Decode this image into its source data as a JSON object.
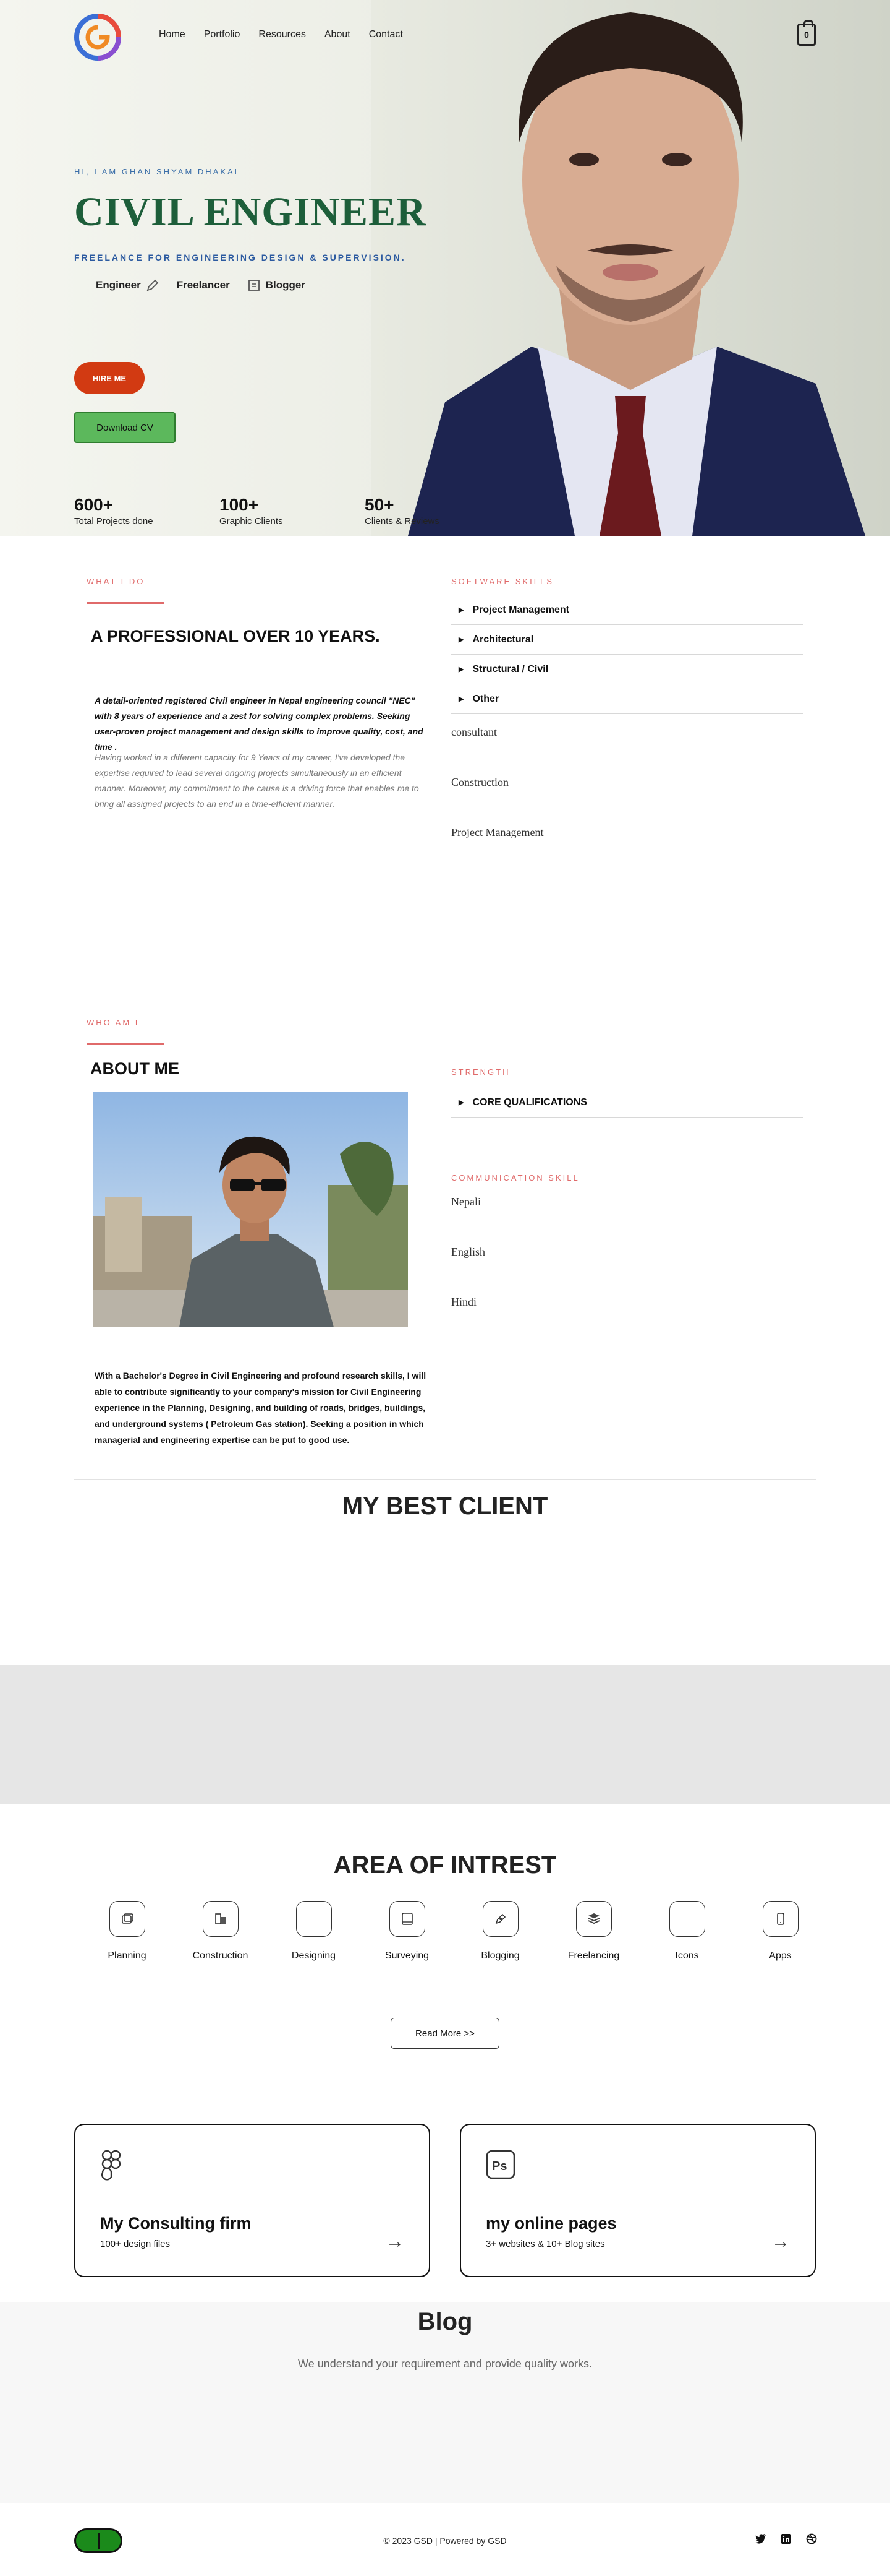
{
  "nav": {
    "items": [
      "Home",
      "Portfolio",
      "Resources",
      "About",
      "Contact"
    ],
    "cart_count": "0"
  },
  "hero": {
    "greeting": "HI, I AM GHAN SHYAM DHAKAL",
    "title": "CIVIL ENGINEER",
    "tagline": "FREELANCE FOR ENGINEERING DESIGN & SUPERVISION.",
    "roles": [
      "Engineer",
      "Freelancer",
      "Blogger"
    ],
    "hire_label": "HIRE ME",
    "cv_label": "Download CV",
    "stats": [
      {
        "number": "600+",
        "label": "Total Projects done"
      },
      {
        "number": "100+",
        "label": "Graphic Clients"
      },
      {
        "number": "50+",
        "label": "Clients & Reviews"
      }
    ]
  },
  "what_i_do": {
    "label": "WHAT I DO",
    "heading": "A PROFESSIONAL OVER 10 YEARS.",
    "intro_bold": "A detail-oriented registered Civil engineer in Nepal engineering council \"NEC\" with 8 years of experience and a zest for solving complex problems. Seeking user-proven project management and design skills to improve quality, cost, and time .",
    "intro_body": "Having worked in a different capacity for 9 Years of my career, I've developed the expertise required to lead several ongoing projects simultaneously in an efficient manner. Moreover, my commitment to the cause is a driving force that enables me to bring all assigned projects to an end in a time-efficient manner."
  },
  "software_skills": {
    "label": "SOFTWARE SKILLS",
    "accordion": [
      "Project Management",
      "Architectural",
      "Structural / Civil",
      "Other"
    ],
    "skills": [
      "consultant",
      "Construction",
      "Project Management"
    ]
  },
  "about": {
    "label": "WHO AM I",
    "heading": "ABOUT ME",
    "text": "With a Bachelor's Degree in Civil Engineering and profound research skills, I will able to contribute significantly to your company's mission for Civil Engineering experience in the Planning, Designing, and building of roads, bridges, buildings, and underground systems ( Petroleum Gas station). Seeking a position in which managerial and engineering expertise can be put to good use."
  },
  "strength": {
    "label": "STRENGTH",
    "accordion": [
      "CORE QUALIFICATIONS"
    ]
  },
  "communication": {
    "label": "COMMUNICATION SKILL",
    "languages": [
      "Nepali",
      "English",
      "Hindi"
    ]
  },
  "clients": {
    "heading": "MY BEST CLIENT"
  },
  "interests": {
    "heading": "AREA OF INTREST",
    "items": [
      {
        "label": "Planning",
        "icon": "layers-icon"
      },
      {
        "label": "Construction",
        "icon": "building-icon"
      },
      {
        "label": "Designing",
        "icon": "blank-icon"
      },
      {
        "label": "Surveying",
        "icon": "tablet-icon"
      },
      {
        "label": "Blogging",
        "icon": "pen-icon"
      },
      {
        "label": "Freelancing",
        "icon": "stack-icon"
      },
      {
        "label": "Icons",
        "icon": "blank-icon"
      },
      {
        "label": "Apps",
        "icon": "phone-icon"
      }
    ],
    "read_more": "Read More >>"
  },
  "cards": [
    {
      "title": "My Consulting firm",
      "subtitle": "100+ design files",
      "icon": "figma-icon"
    },
    {
      "title": "my online pages",
      "subtitle": "3+ websites & 10+ Blog sites",
      "icon": "photoshop-icon"
    }
  ],
  "blog": {
    "title": "Blog",
    "subtitle": "We understand your requirement and provide quality works."
  },
  "footer": {
    "copyright": "© 2023 GSD | Powered by GSD",
    "social_icons": [
      "twitter-icon",
      "linkedin-icon",
      "dribbble-icon"
    ]
  },
  "colors": {
    "accent_red": "#e06a6a",
    "hero_green": "#1d5e3a",
    "hire_orange": "#d23a12",
    "cv_green": "#5cb85c",
    "tagline_blue": "#2c5aa0"
  }
}
